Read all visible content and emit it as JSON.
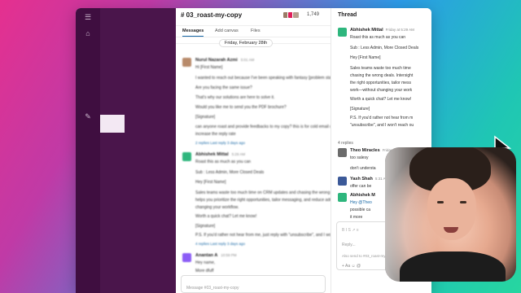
{
  "channel": {
    "name": "# 03_roast-my-copy",
    "member_count": "1,749"
  },
  "tabs": [
    {
      "label": "Messages",
      "active": true
    },
    {
      "label": "Add canvas",
      "active": false
    },
    {
      "label": "Files",
      "active": false
    }
  ],
  "date_divider": "Friday, February 28th",
  "messages": [
    {
      "author": "Nurul Nazarah Azmi",
      "time": "5:01 AM",
      "avatar_color": "#b88a6a",
      "lines": [
        "Hi [First Name]",
        "I wanted to reach out because I've been speaking with fantasy [problem statement].",
        "Are you facing the same issue?",
        "That's why our solutions are here to solve it.",
        "Would you like me to send you the PDF brochure?",
        "[Signature]",
        "can anyone roast and provide feedbacks to my copy? this is for cold email campaign. I want to",
        "increase the reply rate"
      ],
      "replies": "2 replies  Last reply 3 days ago"
    },
    {
      "author": "Abhishek Mittal",
      "time": "5:29 AM",
      "avatar_color": "#2eb67d",
      "lines": [
        "Roast this as much as you can",
        "Sub : Less Admin, More Closed Deals",
        "Hey [First Name]",
        "Sales teams waste too much time on CRM updates and chasing the wrong deals. Intersight's AI",
        "helps you prioritize the right opportunities, tailor messaging, and reduce admin work—without",
        "changing your workflow.",
        "Worth a quick chat? Let me know!",
        "[Signature]",
        "P.S. If you'd rather not hear from me, just reply with \"unsubscribe\", and I won't reach out again."
      ],
      "replies": "4 replies  Last reply 3 days ago"
    },
    {
      "author": "Anantan A",
      "time": "10:59 PM",
      "avatar_color": "#8b5cf6",
      "lines": [
        "Hey name,",
        "More dfuff"
      ],
      "replies": ""
    }
  ],
  "composer": {
    "placeholder": "Message #03_roast-my-copy"
  },
  "thread": {
    "title": "Thread",
    "parent": {
      "author": "Abhishek Mittal",
      "time": "Friday at 5:29 AM",
      "avatar_color": "#2eb67d",
      "lines": [
        "Roast this as much as you can",
        "Sub : Less Admin, More Closed Deals",
        "Hey [First Name]",
        "Sales teams waste too much time",
        "chasing the wrong deals. Intersight",
        "the right opportunities, tailor mess",
        "work—without changing your work",
        "Worth a quick chat? Let me know!",
        "[Signature]",
        "P.S. If you'd rather not hear from m",
        "\"unsubscribe\", and I won't reach ou"
      ]
    },
    "replies_label": "4 replies",
    "replies": [
      {
        "author": "Theo Miracles",
        "time": "Friday at 6:30 AM",
        "avatar_color": "#6b6b6b",
        "lines": [
          "too salesy",
          "don't understa"
        ]
      },
      {
        "author": "Yash Shah",
        "time": "5:31 AM",
        "avatar_color": "#3b5998",
        "lines": [
          "offer can be"
        ]
      },
      {
        "author": "Abhishek M",
        "time": "",
        "avatar_color": "#2eb67d",
        "lines": [
          "Hey @Theo",
          "possible ca",
          "it more"
        ]
      }
    ],
    "composer": {
      "format_bar": "B  I  S  ↗  ≡",
      "placeholder": "Reply...",
      "also_send": "Also send to #03_roast-my-copy",
      "actions": "+  Aa  ☺  @"
    }
  },
  "colors": {
    "sidebar": "#4a154b",
    "rail": "#3f0e40",
    "accent": "#1264a3"
  },
  "icons": {
    "cursor": "arrow-cursor-icon"
  }
}
